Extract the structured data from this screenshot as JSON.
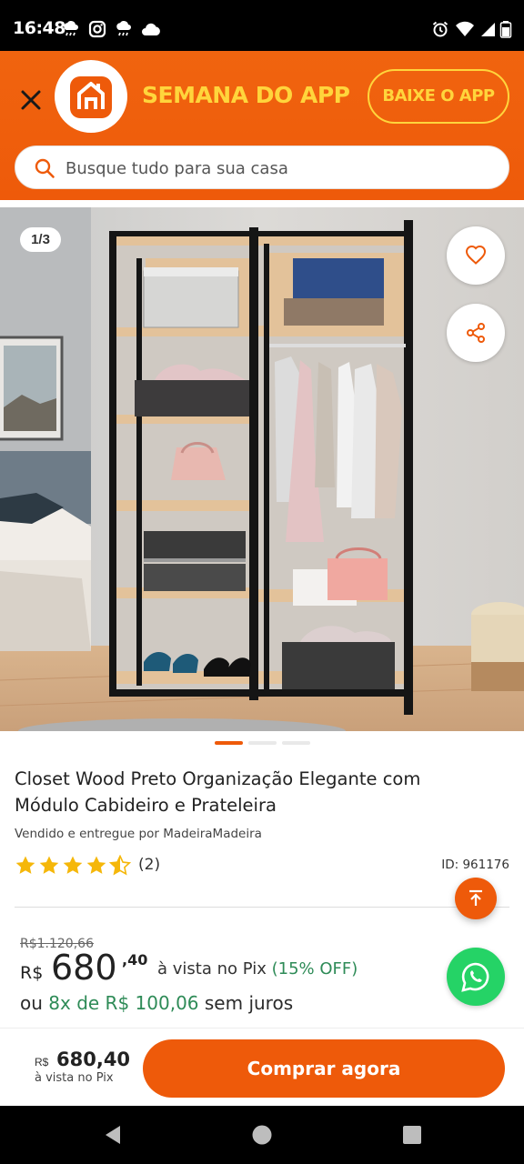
{
  "status_bar": {
    "time": "16:48",
    "left_icons": [
      "cloud-rain-icon",
      "instagram-icon",
      "cloud-rain-icon",
      "cloud-icon"
    ],
    "right_icons": [
      "alarm-icon",
      "wifi-icon",
      "signal-icon",
      "battery-icon"
    ]
  },
  "banner": {
    "promo_text": "SEMANA DO APP",
    "download_label": "BAIXE O APP",
    "colors": {
      "orange": "#ee5a0a",
      "yellow": "#ffd53c"
    }
  },
  "search": {
    "placeholder": "Busque tudo para sua casa"
  },
  "gallery": {
    "counter": "1/3",
    "current_index": 1,
    "total": 3
  },
  "product": {
    "title": "Closet Wood Preto Organização Elegante com Módulo Cabideiro e Prateleira",
    "seller": "Vendido e entregue por MadeiraMadeira",
    "rating": 4.5,
    "rating_count": "(2)",
    "id_text": "ID: 961176"
  },
  "price": {
    "old": "R$1.120,66",
    "currency": "R$",
    "integer": "680",
    "decimal": ",40",
    "pix_prefix": "à vista no Pix",
    "discount": "(15% OFF)",
    "installment_prefix": "ou",
    "installment_value": "8x de R$ 100,06",
    "installment_suffix": "sem juros"
  },
  "buy_bar": {
    "currency": "R$",
    "price": "680,40",
    "subtitle": "à vista no Pix",
    "button_label": "Comprar agora"
  }
}
